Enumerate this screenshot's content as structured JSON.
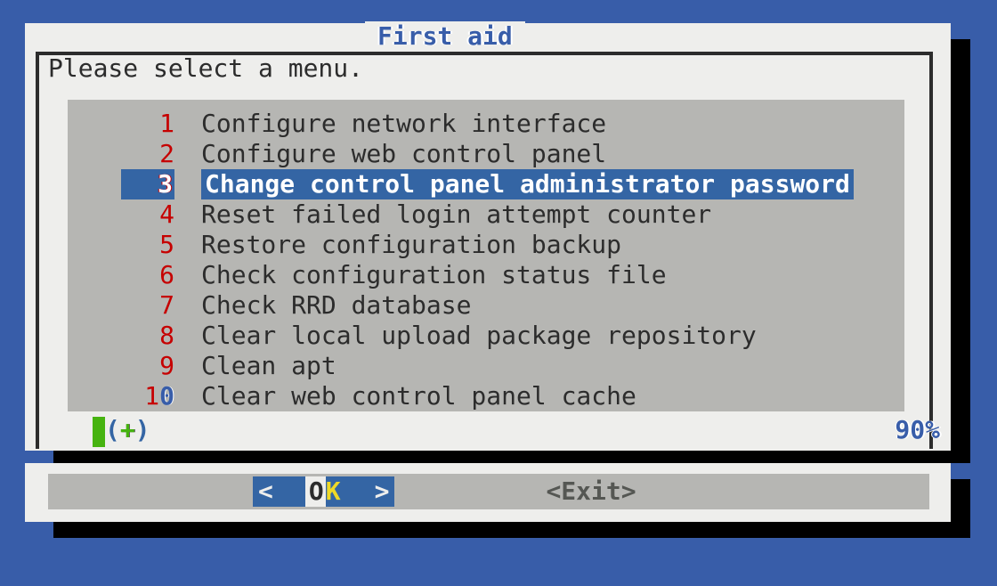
{
  "title": "First aid",
  "prompt": "Please select a menu.",
  "selected_index": 2,
  "menu_items": [
    {
      "num": "1",
      "label": "Configure network interface"
    },
    {
      "num": "2",
      "label": "Configure web control panel"
    },
    {
      "num": "3",
      "label": "Change control panel administrator password"
    },
    {
      "num": "4",
      "label": "Reset failed login attempt counter"
    },
    {
      "num": "5",
      "label": "Restore configuration backup"
    },
    {
      "num": "6",
      "label": "Check configuration status file"
    },
    {
      "num": "7",
      "label": "Check RRD database"
    },
    {
      "num": "8",
      "label": "Clear local upload package repository"
    },
    {
      "num": "9",
      "label": "Clean apt"
    },
    {
      "num": "10",
      "label": "Clear web control panel cache"
    }
  ],
  "status": {
    "more_indicator": "(+)",
    "percent": "90%"
  },
  "buttons": {
    "ok": {
      "open": "<",
      "prefix": "O",
      "accel": "K",
      "close": ">"
    },
    "exit": {
      "open": "<",
      "label_pre": " E",
      "accel": "x",
      "label_post": "it ",
      "close": ">"
    }
  }
}
